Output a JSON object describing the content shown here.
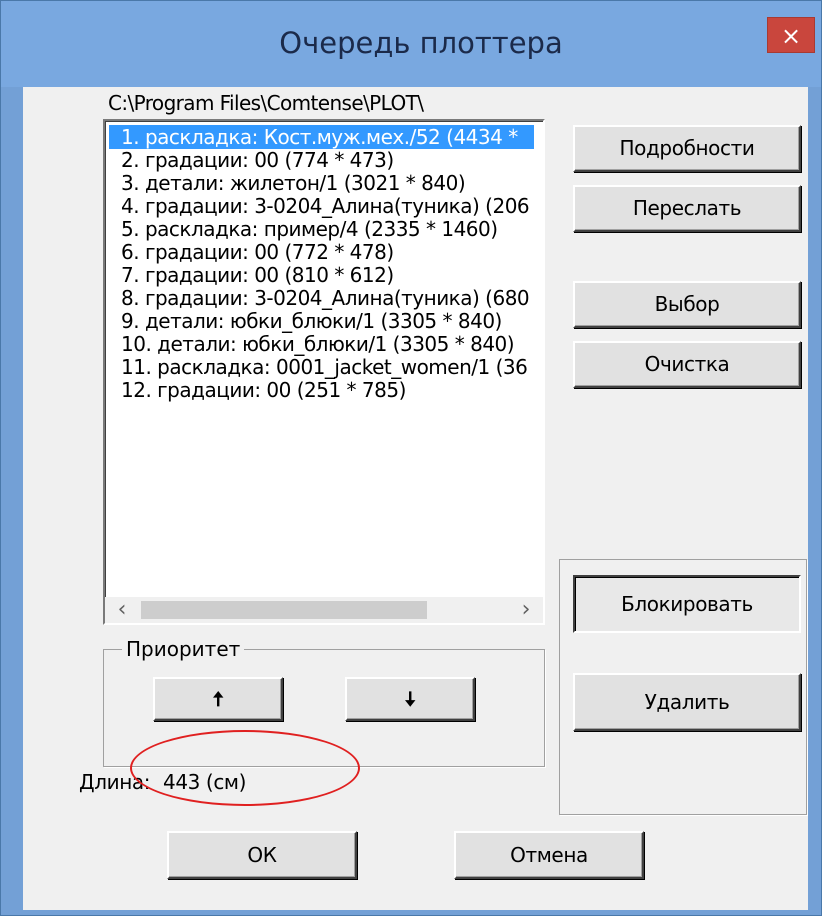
{
  "window": {
    "title": "Очередь плоттера",
    "close_glyph": "×"
  },
  "path": "C:\\Program Files\\Comtense\\PLOT\\",
  "list": {
    "items": [
      "1. раскладка: Кост.муж.мех./52 (4434 *",
      "2. градации: 00 (774 * 473)",
      "3. детали: жилетон/1 (3021 * 840)",
      "4. градации: 3-0204_Алина(туника) (206",
      "5. раскладка: пример/4 (2335 * 1460)",
      "6. градации: 00 (772 * 478)",
      "7. градации: 00 (810 * 612)",
      "8. градации: 3-0204_Алина(туника) (680",
      "9. детали: юбки_блюки/1 (3305 * 840)",
      "10. детали: юбки_блюки/1 (3305 * 840)",
      "11. раскладка: 0001_jacket_women/1 (36",
      "12. градации: 00 (251 * 785)"
    ],
    "selected_index": 0,
    "scroll_left_glyph": "‹",
    "scroll_right_glyph": "›"
  },
  "buttons": {
    "details": "Подробности",
    "forward": "Переслать",
    "select": "Выбор",
    "clear": "Очистка",
    "block": "Блокировать",
    "delete": "Удалить",
    "ok": "ОК",
    "cancel": "Отмена",
    "priority_up": "🠅",
    "priority_down": "🠇"
  },
  "priority": {
    "legend": "Приоритет"
  },
  "length": {
    "label": "Длина:",
    "value": "443 (см)"
  },
  "colors": {
    "selection": "#3399ff",
    "close": "#c9463d",
    "annotation": "#e02020"
  }
}
